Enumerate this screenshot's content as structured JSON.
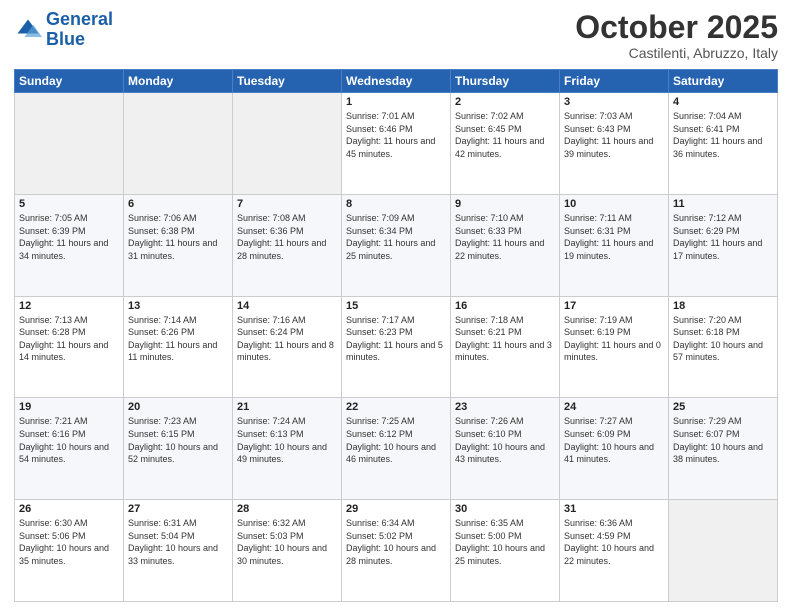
{
  "logo": {
    "line1": "General",
    "line2": "Blue"
  },
  "header": {
    "title": "October 2025",
    "subtitle": "Castilenti, Abruzzo, Italy"
  },
  "weekdays": [
    "Sunday",
    "Monday",
    "Tuesday",
    "Wednesday",
    "Thursday",
    "Friday",
    "Saturday"
  ],
  "weeks": [
    [
      {
        "day": "",
        "sunrise": "",
        "sunset": "",
        "daylight": ""
      },
      {
        "day": "",
        "sunrise": "",
        "sunset": "",
        "daylight": ""
      },
      {
        "day": "",
        "sunrise": "",
        "sunset": "",
        "daylight": ""
      },
      {
        "day": "1",
        "sunrise": "Sunrise: 7:01 AM",
        "sunset": "Sunset: 6:46 PM",
        "daylight": "Daylight: 11 hours and 45 minutes."
      },
      {
        "day": "2",
        "sunrise": "Sunrise: 7:02 AM",
        "sunset": "Sunset: 6:45 PM",
        "daylight": "Daylight: 11 hours and 42 minutes."
      },
      {
        "day": "3",
        "sunrise": "Sunrise: 7:03 AM",
        "sunset": "Sunset: 6:43 PM",
        "daylight": "Daylight: 11 hours and 39 minutes."
      },
      {
        "day": "4",
        "sunrise": "Sunrise: 7:04 AM",
        "sunset": "Sunset: 6:41 PM",
        "daylight": "Daylight: 11 hours and 36 minutes."
      }
    ],
    [
      {
        "day": "5",
        "sunrise": "Sunrise: 7:05 AM",
        "sunset": "Sunset: 6:39 PM",
        "daylight": "Daylight: 11 hours and 34 minutes."
      },
      {
        "day": "6",
        "sunrise": "Sunrise: 7:06 AM",
        "sunset": "Sunset: 6:38 PM",
        "daylight": "Daylight: 11 hours and 31 minutes."
      },
      {
        "day": "7",
        "sunrise": "Sunrise: 7:08 AM",
        "sunset": "Sunset: 6:36 PM",
        "daylight": "Daylight: 11 hours and 28 minutes."
      },
      {
        "day": "8",
        "sunrise": "Sunrise: 7:09 AM",
        "sunset": "Sunset: 6:34 PM",
        "daylight": "Daylight: 11 hours and 25 minutes."
      },
      {
        "day": "9",
        "sunrise": "Sunrise: 7:10 AM",
        "sunset": "Sunset: 6:33 PM",
        "daylight": "Daylight: 11 hours and 22 minutes."
      },
      {
        "day": "10",
        "sunrise": "Sunrise: 7:11 AM",
        "sunset": "Sunset: 6:31 PM",
        "daylight": "Daylight: 11 hours and 19 minutes."
      },
      {
        "day": "11",
        "sunrise": "Sunrise: 7:12 AM",
        "sunset": "Sunset: 6:29 PM",
        "daylight": "Daylight: 11 hours and 17 minutes."
      }
    ],
    [
      {
        "day": "12",
        "sunrise": "Sunrise: 7:13 AM",
        "sunset": "Sunset: 6:28 PM",
        "daylight": "Daylight: 11 hours and 14 minutes."
      },
      {
        "day": "13",
        "sunrise": "Sunrise: 7:14 AM",
        "sunset": "Sunset: 6:26 PM",
        "daylight": "Daylight: 11 hours and 11 minutes."
      },
      {
        "day": "14",
        "sunrise": "Sunrise: 7:16 AM",
        "sunset": "Sunset: 6:24 PM",
        "daylight": "Daylight: 11 hours and 8 minutes."
      },
      {
        "day": "15",
        "sunrise": "Sunrise: 7:17 AM",
        "sunset": "Sunset: 6:23 PM",
        "daylight": "Daylight: 11 hours and 5 minutes."
      },
      {
        "day": "16",
        "sunrise": "Sunrise: 7:18 AM",
        "sunset": "Sunset: 6:21 PM",
        "daylight": "Daylight: 11 hours and 3 minutes."
      },
      {
        "day": "17",
        "sunrise": "Sunrise: 7:19 AM",
        "sunset": "Sunset: 6:19 PM",
        "daylight": "Daylight: 11 hours and 0 minutes."
      },
      {
        "day": "18",
        "sunrise": "Sunrise: 7:20 AM",
        "sunset": "Sunset: 6:18 PM",
        "daylight": "Daylight: 10 hours and 57 minutes."
      }
    ],
    [
      {
        "day": "19",
        "sunrise": "Sunrise: 7:21 AM",
        "sunset": "Sunset: 6:16 PM",
        "daylight": "Daylight: 10 hours and 54 minutes."
      },
      {
        "day": "20",
        "sunrise": "Sunrise: 7:23 AM",
        "sunset": "Sunset: 6:15 PM",
        "daylight": "Daylight: 10 hours and 52 minutes."
      },
      {
        "day": "21",
        "sunrise": "Sunrise: 7:24 AM",
        "sunset": "Sunset: 6:13 PM",
        "daylight": "Daylight: 10 hours and 49 minutes."
      },
      {
        "day": "22",
        "sunrise": "Sunrise: 7:25 AM",
        "sunset": "Sunset: 6:12 PM",
        "daylight": "Daylight: 10 hours and 46 minutes."
      },
      {
        "day": "23",
        "sunrise": "Sunrise: 7:26 AM",
        "sunset": "Sunset: 6:10 PM",
        "daylight": "Daylight: 10 hours and 43 minutes."
      },
      {
        "day": "24",
        "sunrise": "Sunrise: 7:27 AM",
        "sunset": "Sunset: 6:09 PM",
        "daylight": "Daylight: 10 hours and 41 minutes."
      },
      {
        "day": "25",
        "sunrise": "Sunrise: 7:29 AM",
        "sunset": "Sunset: 6:07 PM",
        "daylight": "Daylight: 10 hours and 38 minutes."
      }
    ],
    [
      {
        "day": "26",
        "sunrise": "Sunrise: 6:30 AM",
        "sunset": "Sunset: 5:06 PM",
        "daylight": "Daylight: 10 hours and 35 minutes."
      },
      {
        "day": "27",
        "sunrise": "Sunrise: 6:31 AM",
        "sunset": "Sunset: 5:04 PM",
        "daylight": "Daylight: 10 hours and 33 minutes."
      },
      {
        "day": "28",
        "sunrise": "Sunrise: 6:32 AM",
        "sunset": "Sunset: 5:03 PM",
        "daylight": "Daylight: 10 hours and 30 minutes."
      },
      {
        "day": "29",
        "sunrise": "Sunrise: 6:34 AM",
        "sunset": "Sunset: 5:02 PM",
        "daylight": "Daylight: 10 hours and 28 minutes."
      },
      {
        "day": "30",
        "sunrise": "Sunrise: 6:35 AM",
        "sunset": "Sunset: 5:00 PM",
        "daylight": "Daylight: 10 hours and 25 minutes."
      },
      {
        "day": "31",
        "sunrise": "Sunrise: 6:36 AM",
        "sunset": "Sunset: 4:59 PM",
        "daylight": "Daylight: 10 hours and 22 minutes."
      },
      {
        "day": "",
        "sunrise": "",
        "sunset": "",
        "daylight": ""
      }
    ]
  ]
}
